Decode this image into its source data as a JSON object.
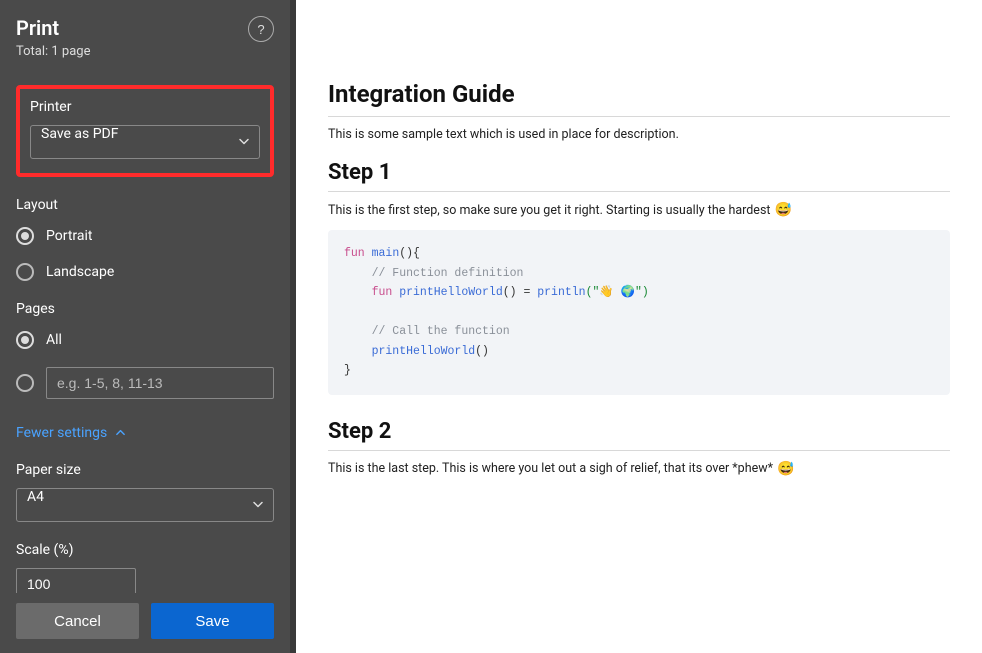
{
  "sidebar": {
    "title": "Print",
    "subtitle": "Total: 1 page",
    "help_label": "?",
    "printer": {
      "label": "Printer",
      "value": "Save as PDF"
    },
    "layout": {
      "label": "Layout",
      "portrait": "Portrait",
      "landscape": "Landscape",
      "selected": "portrait"
    },
    "pages": {
      "label": "Pages",
      "all": "All",
      "range_placeholder": "e.g. 1-5, 8, 11-13",
      "selected": "all"
    },
    "settings_link": "Fewer settings",
    "paper": {
      "label": "Paper size",
      "value": "A4"
    },
    "scale": {
      "label": "Scale (%)",
      "value": "100"
    },
    "cancel": "Cancel",
    "save": "Save"
  },
  "doc": {
    "title": "Integration Guide",
    "description": "This is some sample text which is used in place for description.",
    "step1": {
      "heading": "Step 1",
      "text": "This is the first step, so make sure you get it right. Starting is usually the hardest",
      "emoji": "😅"
    },
    "code": {
      "line1_fun": "fun",
      "line1_name": " main",
      "line1_rest": "(){",
      "line2_comment": "    // Function definition",
      "line3_fun": "    fun",
      "line3_name": " printHelloWorld",
      "line3_mid": "() = ",
      "line3_println": "println",
      "line3_open": "(\"",
      "line3_emoji1": "👋",
      "line3_emoji2": "🌍",
      "line3_close": "\")",
      "line5_comment": "    // Call the function",
      "line6_call": "    printHelloWorld",
      "line6_rest": "()",
      "line7": "}"
    },
    "step2": {
      "heading": "Step 2",
      "text": "This is the last step. This is where you let out a sigh of relief, that its over *phew*",
      "emoji": "😅"
    }
  }
}
